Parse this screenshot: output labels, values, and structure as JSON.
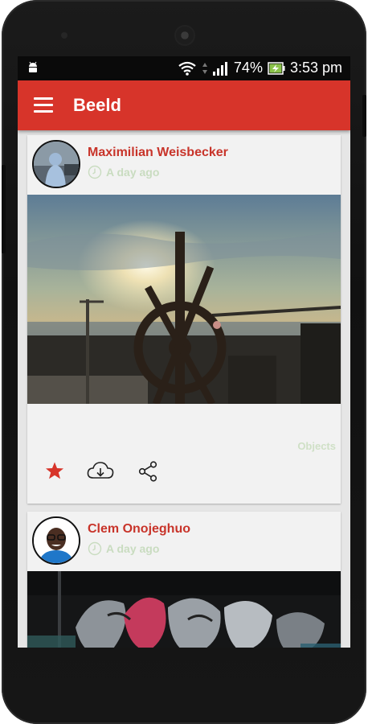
{
  "statusbar": {
    "battery": "74%",
    "time": "3:53 pm"
  },
  "toolbar": {
    "title": "Beeld"
  },
  "posts": [
    {
      "author": "Maximilian Weisbecker",
      "time": "A day ago",
      "category": "Objects",
      "starred": true
    },
    {
      "author": "Clem Onojeghuo",
      "time": "A day ago"
    }
  ],
  "colors": {
    "accent": "#d7342a",
    "author_text": "#c8342a",
    "meta_text": "#c9dcc0",
    "card_bg": "#f2f2f2",
    "feed_bg": "#e6e6e6"
  },
  "icons": {
    "menu": "hamburger-menu-icon",
    "clock": "clock-icon",
    "star": "star-icon",
    "download": "cloud-download-icon",
    "share": "share-icon",
    "wifi": "wifi-icon",
    "signal": "signal-icon",
    "battery": "battery-charging-icon",
    "notification": "android-notification-icon"
  }
}
